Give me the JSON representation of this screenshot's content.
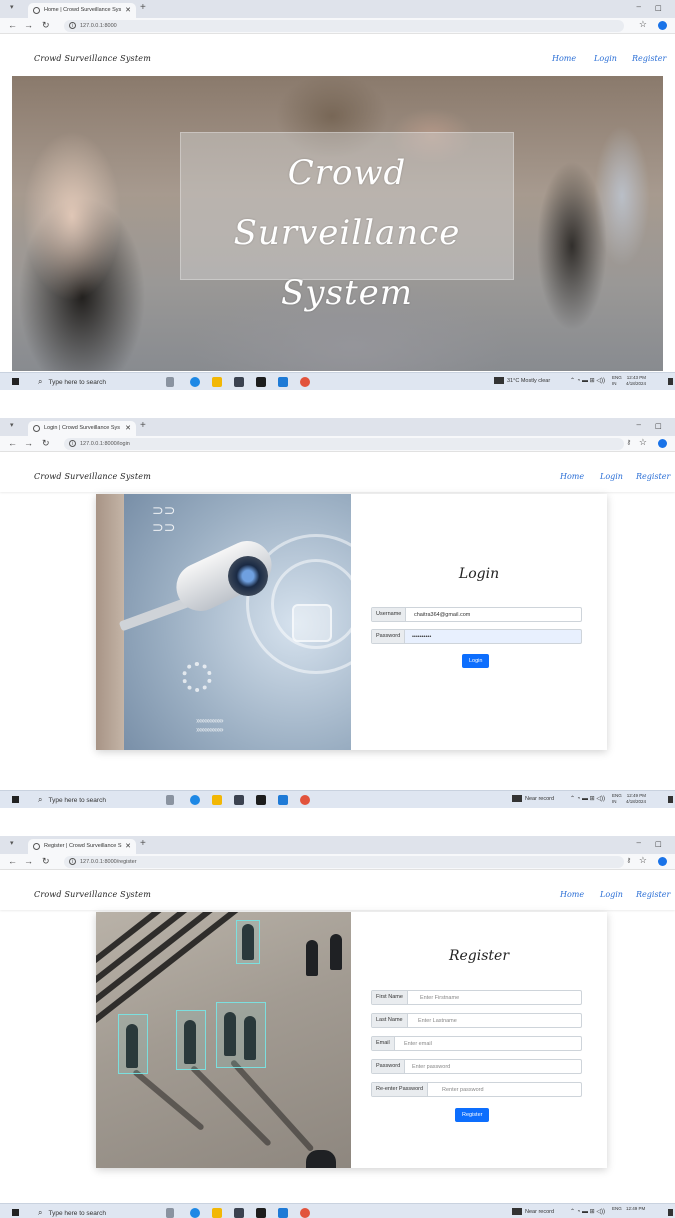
{
  "browser": {
    "url_home": "127.0.0.1:8000",
    "url_login": "127.0.0.1:8000/login",
    "url_register": "127.0.0.1:8000/register",
    "tab_home": "Home | Crowd Surveillance Sys",
    "tab_login": "Login | Crowd Surveillance Sys",
    "tab_register": "Register | Crowd Surveillance S"
  },
  "navbar": {
    "brand": "Crowd Surveillance System",
    "home": "Home",
    "login": "Login",
    "register": "Register"
  },
  "hero": {
    "title_line1": "Crowd Surveillance",
    "title_line2": "System"
  },
  "login_form": {
    "title": "Login",
    "username_label": "Username",
    "username_value": "chaitra364@gmail.com",
    "password_label": "Password",
    "password_value": "••••••••••",
    "submit": "Login"
  },
  "register_form": {
    "title": "Register",
    "first_name_label": "First Name",
    "first_name_placeholder": "Enter Firstname",
    "last_name_label": "Last Name",
    "last_name_placeholder": "Enter Lastname",
    "email_label": "Email",
    "email_placeholder": "Enter email",
    "password_label": "Password",
    "password_placeholder": "Enter password",
    "reenter_label": "Re-enter Password",
    "reenter_placeholder": "Renter password",
    "submit": "Register"
  },
  "taskbar": {
    "search": "Type here to search",
    "weather_1": "31°C Mostly clear",
    "weather_2": "Near record",
    "lang_1": "ENG",
    "lang_2": "IN",
    "time_1": "12:43 PM",
    "time_2": "12:49 PM",
    "time_3": "12:49 PM",
    "date": "4/18/2024"
  },
  "colors": {
    "link": "#2b6fd6",
    "button": "#0d6efd",
    "taskbar": "#dfe6f1"
  }
}
